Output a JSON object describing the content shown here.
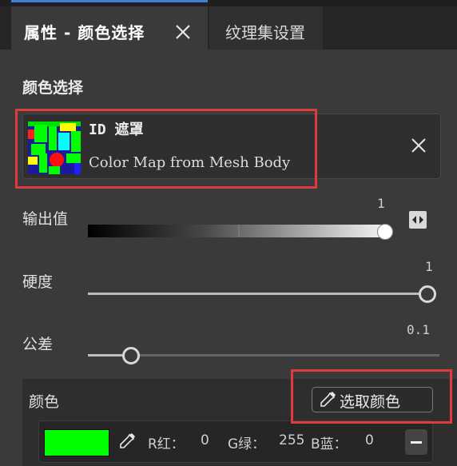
{
  "tabs": [
    {
      "label": "属性 - 颜色选择",
      "active": true
    },
    {
      "label": "纹理集设置",
      "active": false
    }
  ],
  "section_title": "颜色选择",
  "mask": {
    "name": "ID 遮罩",
    "source": "Color Map from Mesh Body"
  },
  "params": {
    "output": {
      "label": "输出值",
      "value": "1",
      "level": 1.0
    },
    "hardness": {
      "label": "硬度",
      "value": "1",
      "level": 1.0
    },
    "tolerance": {
      "label": "公差",
      "value": "0.1",
      "level": 0.1
    }
  },
  "color": {
    "label": "颜色",
    "pick_button": "选取颜色",
    "swatch_color": "#00ff00",
    "r_label": "R红：",
    "r_value": "0",
    "g_label": "G绿：",
    "g_value": "255",
    "b_label": "B蓝：",
    "b_value": "0"
  },
  "icons": {
    "tab_close": "close-icon",
    "mask_remove": "close-icon",
    "reset": "reset-icon",
    "picker": "eyedropper-icon",
    "remove_color": "minus-icon"
  },
  "colors": {
    "accent": "#3f7fd1",
    "highlight_box": "#e0393e",
    "background": "#3a3a3a"
  }
}
